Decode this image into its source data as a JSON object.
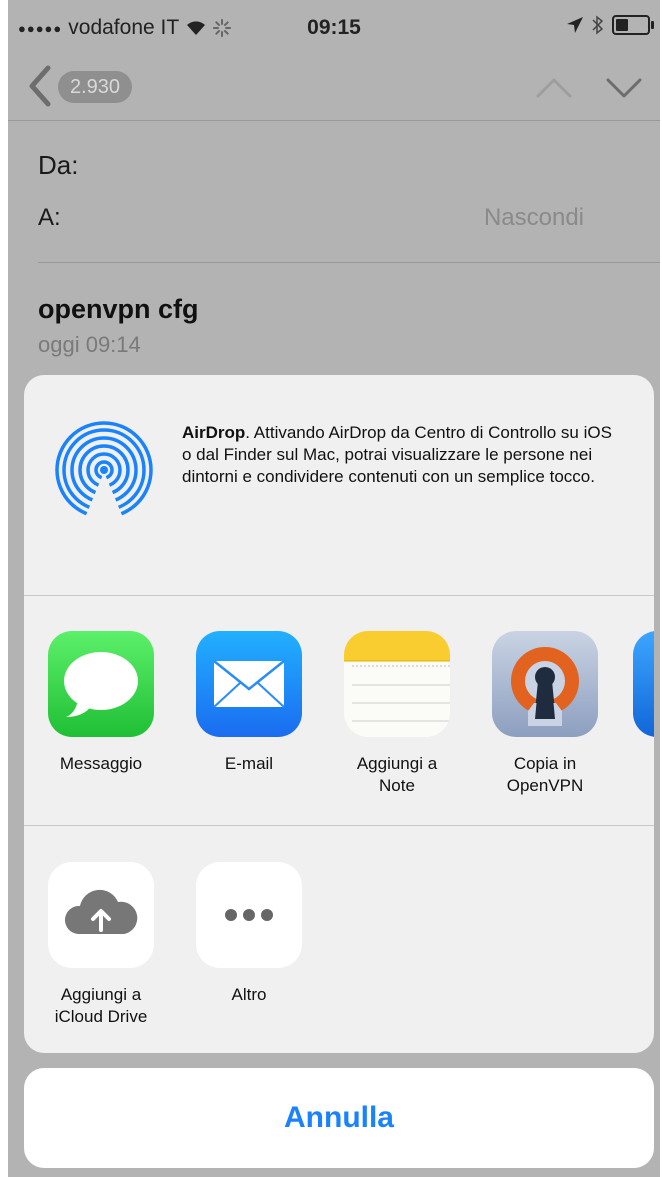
{
  "status_bar": {
    "carrier": "vodafone IT",
    "time": "09:15"
  },
  "nav": {
    "message_count": "2.930"
  },
  "mail": {
    "from_label": "Da:",
    "to_label": "A:",
    "hide_link": "Nascondi",
    "subject": "openvpn cfg",
    "date": "oggi 09:14"
  },
  "airdrop": {
    "title": "AirDrop",
    "description": ". Attivando AirDrop da Centro di Controllo su iOS o dal Finder sul Mac, potrai visualizzare le persone nei dintorni e condividere contenuti con un semplice tocco.",
    "icon": "airdrop-icon"
  },
  "share_apps": [
    {
      "label": "Messaggio",
      "icon": "messages-icon"
    },
    {
      "label": "E-mail",
      "icon": "mail-icon"
    },
    {
      "label": "Aggiungi a Note",
      "icon": "notes-icon"
    },
    {
      "label": "Copia in OpenVPN",
      "icon": "openvpn-icon"
    }
  ],
  "share_actions": [
    {
      "label": "Aggiungi a iCloud Drive",
      "icon": "icloud-upload-icon"
    },
    {
      "label": "Altro",
      "icon": "more-icon"
    }
  ],
  "cancel_label": "Annulla",
  "colors": {
    "accent": "#1a82fb",
    "dim_background": "#b3b3b3",
    "sheet_background": "#f0f0f0"
  }
}
